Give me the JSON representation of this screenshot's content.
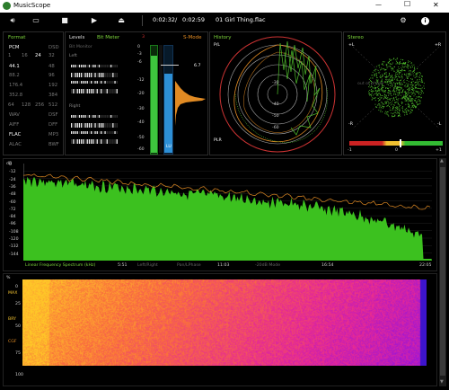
{
  "app": {
    "title": "MusicScope"
  },
  "window_controls": {
    "minimize": "—",
    "maximize": "☐",
    "close": "✕"
  },
  "toolbar": {
    "elapsed": "0:02:32",
    "separator": "/",
    "total": "0:02:59",
    "track": "01 Girl Thing.flac"
  },
  "format_panel": {
    "title": "Format",
    "rows": [
      [
        "PCM",
        "DSD"
      ],
      [
        "1",
        "16",
        "24",
        "32"
      ],
      [
        "44.1",
        "48"
      ],
      [
        "88.2",
        "96"
      ],
      [
        "176.4",
        "192"
      ],
      [
        "352.8",
        "384"
      ],
      [
        "64",
        "128",
        "256",
        "512"
      ],
      [
        "WAV",
        "DSF"
      ],
      [
        "AIFF",
        "DFF"
      ],
      [
        "FLAC",
        "MP3"
      ],
      [
        "ALAC",
        "BWF"
      ]
    ]
  },
  "levels_panel": {
    "title": "Levels",
    "mode": "Bit Meter",
    "bit_monitor": "Bit Monitor",
    "left": "Left",
    "right": "Right",
    "smode": "S-Mode",
    "marker_left": "3",
    "ticks": [
      "0",
      "-3",
      "-6",
      "-12",
      "-20",
      "-30",
      "-40",
      "-50",
      "-60"
    ],
    "peak_value": "6.7",
    "lu_label": "LU"
  },
  "history_panel": {
    "title": "History",
    "plr": "PLR",
    "pl": "P/L",
    "rings": [
      "-30",
      "-40",
      "-50",
      "-60"
    ]
  },
  "stereo_panel": {
    "title": "Stereo",
    "axes": {
      "ul": "+L",
      "ur": "+R",
      "ll": "-R",
      "lr": "-L"
    },
    "correlation_labels": [
      "-1",
      "0",
      "+1"
    ],
    "phase_text": "out of phase"
  },
  "spectrum": {
    "ylabels": [
      "dB",
      "0",
      "-12",
      "-24",
      "-36",
      "-48",
      "-60",
      "-72",
      "-84",
      "-96",
      "-108",
      "-120",
      "-132",
      "-144"
    ],
    "xlabels": [
      "5:51",
      "11:03",
      "16:54",
      "22:05"
    ],
    "caption": "Linear Frequency Spectrum (kHz)",
    "options": [
      "Left/Right",
      "Pan/LPhase",
      "-20dB Mode"
    ]
  },
  "spectrogram": {
    "ylabels": [
      "%",
      "0",
      "25",
      "50",
      "75",
      "100"
    ],
    "side_labels": [
      "MAX",
      "BRY",
      "CGF"
    ]
  },
  "colors": {
    "accent_green": "#7bd23b",
    "accent_orange": "#e08a23",
    "accent_red": "#d33030",
    "meter_blue": "#2d8fd6"
  }
}
